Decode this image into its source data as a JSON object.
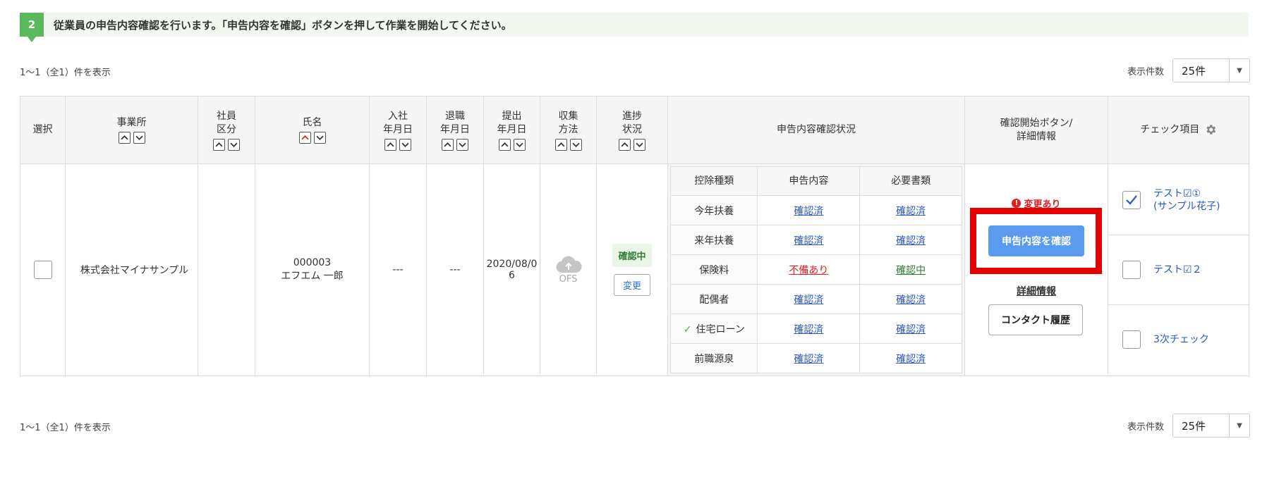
{
  "banner": {
    "step_number": "2",
    "text": "従業員の申告内容確認を行います。「申告内容を確認」ボタンを押して作業を開始してください。"
  },
  "pagination": {
    "count_text": "1〜1（全1）件を表示",
    "per_page_label": "表示件数",
    "per_page_value": "25件"
  },
  "table": {
    "headers": {
      "select": "選択",
      "office": "事業所",
      "emp_type_1": "社員",
      "emp_type_2": "区分",
      "name": "氏名",
      "join_1": "入社",
      "join_2": "年月日",
      "leave_1": "退職",
      "leave_2": "年月日",
      "submit_1": "提出",
      "submit_2": "年月日",
      "collect_1": "収集",
      "collect_2": "方法",
      "progress_1": "進捗",
      "progress_2": "状況",
      "review_status": "申告内容確認状況",
      "confirm_1": "確認開始ボタン/",
      "confirm_2": "詳細情報",
      "check_items": "チェック項目"
    },
    "row": {
      "office": "株式会社マイナサンプル",
      "emp_id": "000003",
      "emp_name": "エフエム 一郎",
      "join_date": "---",
      "leave_date": "---",
      "submit_date_1": "2020/08/0",
      "submit_date_2": "6",
      "collect_method": "OFS",
      "progress_status": "確認中",
      "change_button": "変更"
    },
    "review": {
      "headers": {
        "kind": "控除種類",
        "content": "申告内容",
        "docs": "必要書類"
      },
      "rows": [
        {
          "kind": "今年扶養",
          "content": "確認済",
          "docs": "確認済"
        },
        {
          "kind": "来年扶養",
          "content": "確認済",
          "docs": "確認済"
        },
        {
          "kind": "保険料",
          "content": "不備あり",
          "docs": "確認中"
        },
        {
          "kind": "配偶者",
          "content": "確認済",
          "docs": "確認済"
        },
        {
          "kind": "住宅ローン",
          "content": "確認済",
          "docs": "確認済"
        },
        {
          "kind": "前職源泉",
          "content": "確認済",
          "docs": "確認済"
        }
      ]
    },
    "confirm": {
      "changed_note": "変更あり",
      "confirm_button": "申告内容を確認",
      "detail_link": "詳細情報",
      "contact_button": "コンタクト履歴"
    },
    "check_items": {
      "item1_line1": "テスト☑①",
      "item1_line2": "(サンプル花子)",
      "item1_checked": true,
      "item2": "テスト☑２",
      "item3": "3次チェック"
    }
  },
  "colors": {
    "banner_bg": "#f2f8ef",
    "step_green": "#5cb85c",
    "confirm_button": "#5b9bef",
    "highlight_red": "#e60000",
    "link_blue": "#2a56c6"
  }
}
